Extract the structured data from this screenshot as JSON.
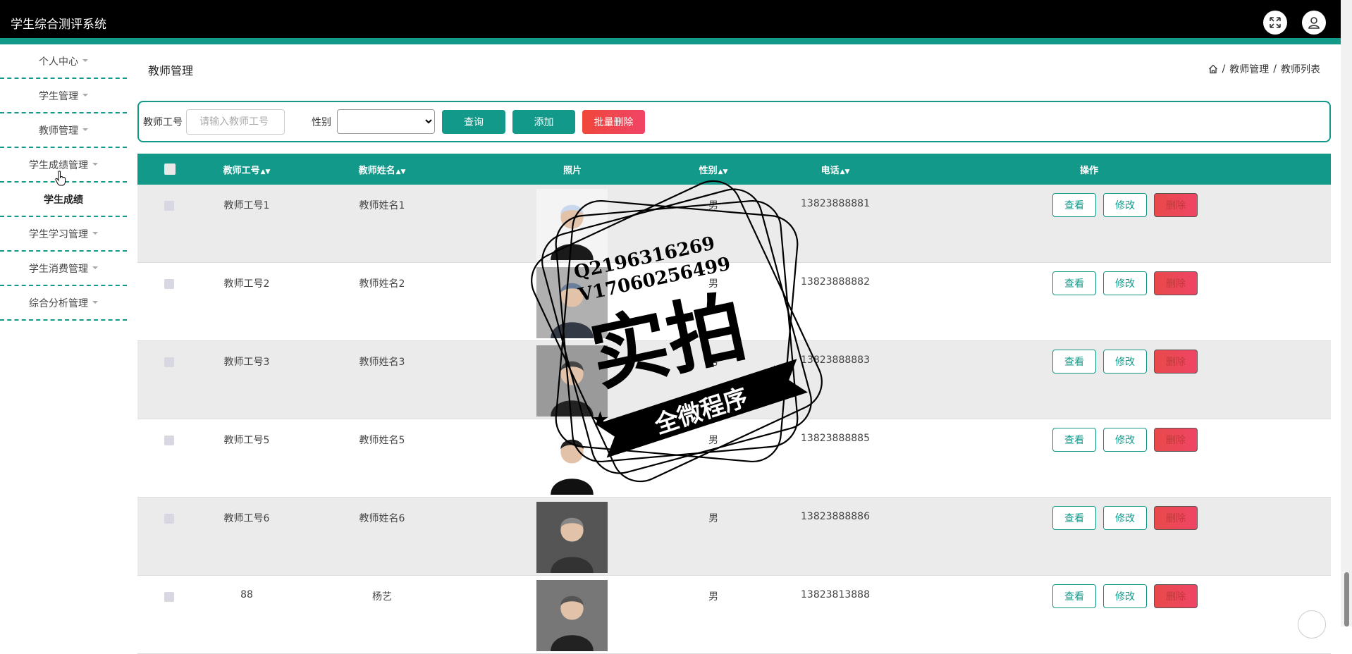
{
  "app": {
    "title": "学生综合测评系统"
  },
  "header": {
    "fullscreen_icon": "fullscreen-icon",
    "user_icon": "user-icon"
  },
  "sidebar": {
    "items": [
      {
        "label": "个人中心",
        "has_caret": true
      },
      {
        "label": "学生管理",
        "has_caret": true
      },
      {
        "label": "教师管理",
        "has_caret": true
      },
      {
        "label": "学生成绩管理",
        "has_caret": true
      },
      {
        "label": "学生成绩",
        "has_caret": false,
        "sub": true
      },
      {
        "label": "学生学习管理",
        "has_caret": true
      },
      {
        "label": "学生消费管理",
        "has_caret": true
      },
      {
        "label": "综合分析管理",
        "has_caret": true
      }
    ]
  },
  "page": {
    "title": "教师管理",
    "breadcrumb": {
      "home_icon": "home-icon",
      "sep": "/",
      "level1": "教师管理",
      "level2": "教师列表"
    }
  },
  "search": {
    "teacher_id_label": "教师工号",
    "teacher_id_placeholder": "请输入教师工号",
    "gender_label": "性别",
    "gender_value": "",
    "query_label": "查询",
    "add_label": "添加",
    "batch_delete_label": "批量删除",
    "colors": {
      "query": "#12998a",
      "add": "#12998a",
      "batch_delete": "#f04466"
    }
  },
  "table": {
    "columns": [
      "教师工号",
      "教师姓名",
      "照片",
      "性别",
      "电话",
      "操作"
    ],
    "sortable": [
      true,
      true,
      false,
      true,
      true,
      false
    ],
    "rows": [
      {
        "id": "教师工号1",
        "name": "教师姓名1",
        "gender": "男",
        "phone": "13823888881"
      },
      {
        "id": "教师工号2",
        "name": "教师姓名2",
        "gender": "男",
        "phone": "13823888882"
      },
      {
        "id": "教师工号3",
        "name": "教师姓名3",
        "gender": "男",
        "phone": "13823888883"
      },
      {
        "id": "教师工号5",
        "name": "教师姓名5",
        "gender": "男",
        "phone": "13823888885"
      },
      {
        "id": "教师工号6",
        "name": "教师姓名6",
        "gender": "男",
        "phone": "13823888886"
      },
      {
        "id": "88",
        "name": "杨艺",
        "gender": "男",
        "phone": "13823813888"
      }
    ],
    "actions": {
      "view": "查看",
      "edit": "修改",
      "delete": "删除"
    }
  },
  "watermark": {
    "line1": "Q2196316269",
    "line2": "V17060256499",
    "big_text": "实拍",
    "ribbon_text": "全微程序"
  },
  "theme": {
    "accent": "#12998a",
    "danger": "#f04466",
    "header_bg": "#000000"
  }
}
